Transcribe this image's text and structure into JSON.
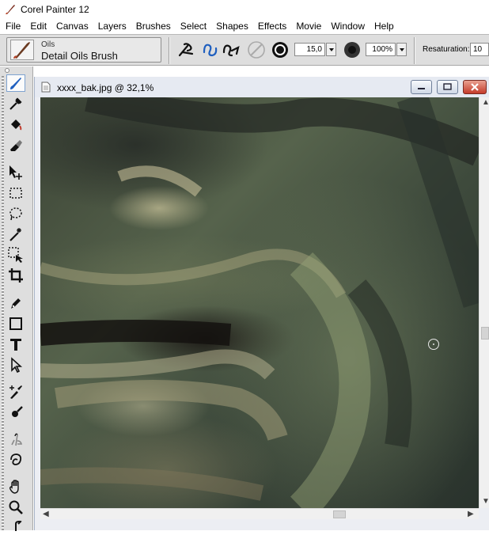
{
  "app": {
    "title": "Corel Painter 12"
  },
  "menu": [
    "File",
    "Edit",
    "Canvas",
    "Layers",
    "Brushes",
    "Select",
    "Shapes",
    "Effects",
    "Movie",
    "Window",
    "Help"
  ],
  "brush": {
    "category": "Oils",
    "variant": "Detail Oils Brush"
  },
  "property_bar": {
    "size_value": "15,0",
    "opacity_value": "100%",
    "resaturation_label": "Resaturation:",
    "resaturation_value": "10"
  },
  "document": {
    "title": "xxxx_bak.jpg @ 32,1%"
  },
  "toolbox": {
    "tools": [
      "brush-tool",
      "dropper-tool",
      "paint-bucket-tool",
      "eraser-tool",
      "layer-adjuster-tool",
      "rectangular-selection-tool",
      "lasso-tool",
      "magic-wand-tool",
      "transform-selection-tool",
      "crop-tool",
      "pen-tool",
      "rectangle-shape-tool",
      "text-tool",
      "shape-selection-tool",
      "cloner-tool",
      "rubber-stamp-tool",
      "dodge-tool",
      "burn-tool",
      "grabber-tool",
      "magnifier-tool",
      "rotate-page-tool"
    ],
    "active": "brush-tool"
  },
  "colors": {
    "chrome": "#dedede",
    "doc_titlebar": "#e6eaf2",
    "close_button": "#c43b2a",
    "selection_accent": "#7fa3d0"
  }
}
